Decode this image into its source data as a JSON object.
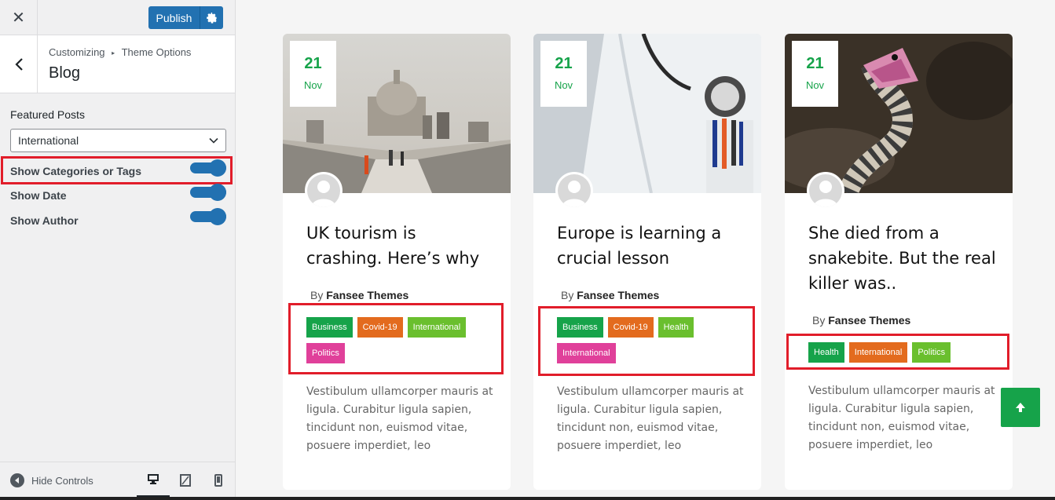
{
  "topbar": {
    "close_glyph": "✕",
    "publish_label": "Publish"
  },
  "section": {
    "breadcrumb_root": "Customizing",
    "breadcrumb_sep": "▸",
    "breadcrumb_parent": "Theme Options",
    "title": "Blog"
  },
  "controls": {
    "featured_label": "Featured Posts",
    "featured_value": "International",
    "show_categories_label": "Show Categories or Tags",
    "show_categories_on": true,
    "show_date_label": "Show Date",
    "show_date_on": true,
    "show_author_label": "Show Author",
    "show_author_on": true
  },
  "footer": {
    "hide_controls": "Hide Controls",
    "devices": [
      "desktop-icon",
      "tablet-icon",
      "mobile-icon"
    ]
  },
  "colors": {
    "accent": "#2271b1",
    "green": "#16a34a",
    "highlight": "#e11d2a",
    "tag_business": "#16a34a",
    "tag_covid": "#e36b1e",
    "tag_international_lime": "#6abf2e",
    "tag_politics": "#e0409a"
  },
  "posts": [
    {
      "day": "21",
      "month": "Nov",
      "title": "UK tourism is crashing. Here’s why",
      "by": "By",
      "author": "Fansee Themes",
      "tags": [
        "Business",
        "Covid-19",
        "International",
        "Politics"
      ],
      "excerpt": "Vestibulum ullamcorper mauris at ligula. Curabitur ligula sapien, tincidunt non, euismod vitae, posuere imperdiet, leo"
    },
    {
      "day": "21",
      "month": "Nov",
      "title": "Europe is learning a crucial lesson",
      "by": "By",
      "author": "Fansee Themes",
      "tags": [
        "Business",
        "Covid-19",
        "Health",
        "International"
      ],
      "excerpt": "Vestibulum ullamcorper mauris at ligula. Curabitur ligula sapien, tincidunt non, euismod vitae, posuere imperdiet, leo"
    },
    {
      "day": "21",
      "month": "Nov",
      "title": "She died from a snakebite. But the real killer was..",
      "by": "By",
      "author": "Fansee Themes",
      "tags": [
        "Health",
        "International",
        "Politics"
      ],
      "excerpt": "Vestibulum ullamcorper mauris at ligula. Curabitur ligula sapien, tincidunt non, euismod vitae, posuere imperdiet, leo"
    }
  ]
}
